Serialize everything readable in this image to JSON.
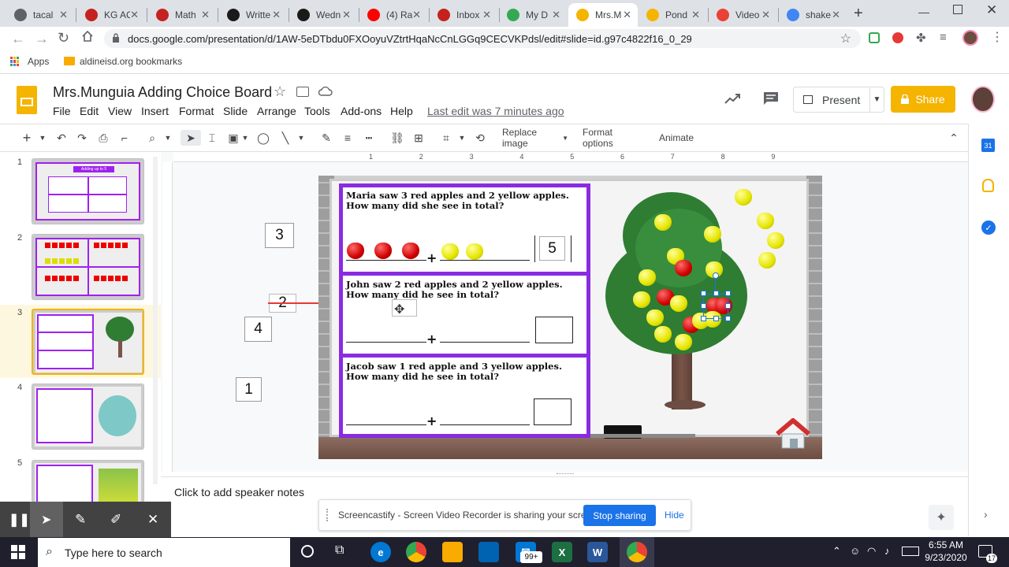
{
  "browser": {
    "tabs": [
      {
        "title": "tacal",
        "color": "#5f6368"
      },
      {
        "title": "KG AC",
        "color": "#c5221f"
      },
      {
        "title": "Math",
        "color": "#c5221f"
      },
      {
        "title": "Writte",
        "color": "#1a1a1a"
      },
      {
        "title": "Wedn",
        "color": "#1a1a1a"
      },
      {
        "title": "(4) Ra",
        "color": "#ff0000"
      },
      {
        "title": "Inbox",
        "color": "#c5221f"
      },
      {
        "title": "My D",
        "color": "#34a853"
      },
      {
        "title": "Mrs.M",
        "color": "#f4b400"
      },
      {
        "title": "Pond",
        "color": "#f4b400"
      },
      {
        "title": "Video",
        "color": "#e94235"
      },
      {
        "title": "shake",
        "color": "#4285f4"
      }
    ],
    "url": "docs.google.com/presentation/d/1AW-5eDTbdu0FXOoyuVZtrtHqaNcCnLGGq9CECVKPdsl/edit#slide=id.g97c4822f16_0_29",
    "bookmarks": {
      "apps": "Apps",
      "folder": "aldineisd.org bookmarks"
    }
  },
  "slides_header": {
    "title": "Mrs.Munguia Adding Choice Board",
    "menu": [
      "File",
      "Edit",
      "View",
      "Insert",
      "Format",
      "Slide",
      "Arrange",
      "Tools",
      "Add-ons",
      "Help"
    ],
    "last_edit": "Last edit was 7 minutes ago",
    "present_label": "Present",
    "share_label": "Share"
  },
  "toolbar": {
    "replace_image": "Replace image",
    "format_options": "Format options",
    "animate": "Animate"
  },
  "ruler": [
    "1",
    "2",
    "3",
    "4",
    "5",
    "6",
    "7",
    "8",
    "9"
  ],
  "filmstrip": {
    "numbers": [
      "1",
      "2",
      "3",
      "4",
      "5"
    ],
    "thumb1_title": "Adding up to 5"
  },
  "canvas": {
    "loose_numbers": [
      "3",
      "2",
      "4",
      "1"
    ],
    "questions": [
      "Maria saw 3 red apples and 2 yellow apples. How many did she see in total?",
      "John saw 2 red apples and 2 yellow apples. How many did he see in total?",
      "Jacob saw 1 red apple and 3 yellow apples. How many did he see in total?"
    ],
    "answer_1": "5",
    "plus": "+"
  },
  "speaker_notes": "Click to add speaker notes",
  "screencastify": {
    "message": "Screencastify - Screen Video Recorder is sharing your screen.",
    "stop": "Stop sharing",
    "hide": "Hide"
  },
  "taskbar": {
    "search": "Type here to search",
    "time": "6:55 AM",
    "date": "9/23/2020",
    "badge": "99+",
    "notif": "17"
  },
  "colors": {
    "accent": "#f4b400",
    "purple": "#8a2be2",
    "blue": "#1a73e8"
  }
}
